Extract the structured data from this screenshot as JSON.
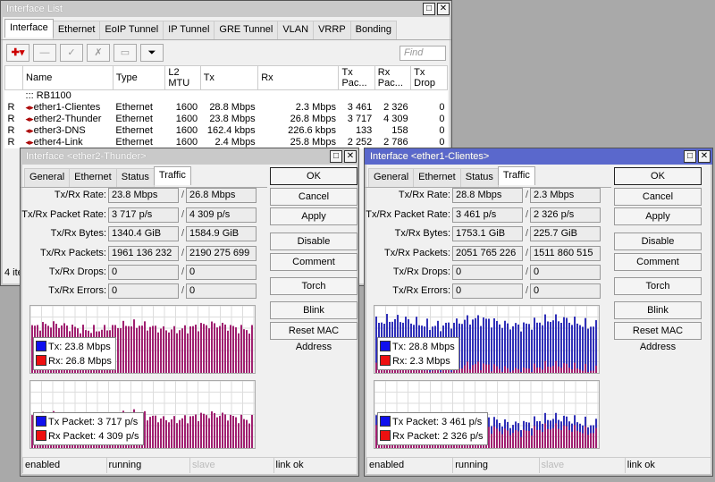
{
  "interface_list": {
    "title": "Interface List",
    "tabs": [
      "Interface",
      "Ethernet",
      "EoIP Tunnel",
      "IP Tunnel",
      "GRE Tunnel",
      "VLAN",
      "VRRP",
      "Bonding"
    ],
    "find_placeholder": "Find",
    "columns": [
      "",
      "Name",
      "Type",
      "L2 MTU",
      "Tx",
      "Rx",
      "Tx Pac...",
      "Rx Pac...",
      "Tx Drop"
    ],
    "group": "::: RB1100",
    "rows": [
      {
        "flag": "R",
        "name": "ether1-Clientes",
        "type": "Ethernet",
        "mtu": "1600",
        "tx": "28.8 Mbps",
        "rx": "2.3 Mbps",
        "txp": "3 461",
        "rxp": "2 326",
        "txd": "0"
      },
      {
        "flag": "R",
        "name": "ether2-Thunder",
        "type": "Ethernet",
        "mtu": "1600",
        "tx": "23.8 Mbps",
        "rx": "26.8 Mbps",
        "txp": "3 717",
        "rxp": "4 309",
        "txd": "0"
      },
      {
        "flag": "R",
        "name": "ether3-DNS",
        "type": "Ethernet",
        "mtu": "1600",
        "tx": "162.4 kbps",
        "rx": "226.6 kbps",
        "txp": "133",
        "rxp": "158",
        "txd": "0"
      },
      {
        "flag": "R",
        "name": "ether4-Link",
        "type": "Ethernet",
        "mtu": "1600",
        "tx": "2.4 Mbps",
        "rx": "25.8 Mbps",
        "txp": "2 252",
        "rxp": "2 786",
        "txd": "0"
      }
    ],
    "item_count": "4 ite"
  },
  "detail_tabs": [
    "General",
    "Ethernet",
    "Status",
    "Traffic"
  ],
  "field_labels": [
    "Tx/Rx Rate:",
    "Tx/Rx Packet Rate:",
    "Tx/Rx Bytes:",
    "Tx/Rx Packets:",
    "Tx/Rx Drops:",
    "Tx/Rx Errors:"
  ],
  "buttons": [
    "OK",
    "Cancel",
    "Apply",
    "Disable",
    "Comment",
    "Torch",
    "Blink",
    "Reset MAC Address"
  ],
  "status": [
    "enabled",
    "running",
    "slave",
    "link ok"
  ],
  "windows": [
    {
      "title": "Interface <ether2-Thunder>",
      "values": [
        [
          "23.8 Mbps",
          "26.8 Mbps"
        ],
        [
          "3 717 p/s",
          "4 309 p/s"
        ],
        [
          "1340.4 GiB",
          "1584.9 GiB"
        ],
        [
          "1961 136 232",
          "2190 275 699"
        ],
        [
          "0",
          "0"
        ],
        [
          "0",
          "0"
        ]
      ],
      "legend1": [
        "Tx:  23.8 Mbps",
        "Rx:  26.8 Mbps"
      ],
      "legend2": [
        "Tx Packet:  3 717 p/s",
        "Rx Packet:  4 309 p/s"
      ],
      "levels": {
        "g1_tx": 0.6,
        "g1_rx": 0.68,
        "g2_tx": 0.4,
        "g2_rx": 0.46
      }
    },
    {
      "title": "Interface <ether1-Clientes>",
      "values": [
        [
          "28.8 Mbps",
          "2.3 Mbps"
        ],
        [
          "3 461 p/s",
          "2 326 p/s"
        ],
        [
          "1753.1 GiB",
          "225.7 GiB"
        ],
        [
          "2051 765 226",
          "1511 860 515"
        ],
        [
          "0",
          "0"
        ],
        [
          "0",
          "0"
        ]
      ],
      "legend1": [
        "Tx:  28.8 Mbps",
        "Rx:  2.3 Mbps"
      ],
      "legend2": [
        "Tx Packet:  3 461 p/s",
        "Rx Packet:  2 326 p/s"
      ],
      "levels": {
        "g1_tx": 0.75,
        "g1_rx": 0.08,
        "g2_tx": 0.4,
        "g2_rx": 0.27
      }
    }
  ],
  "colors": {
    "tx": "#1010ee",
    "rx": "#ee1010",
    "active_title": "#5a68cc"
  }
}
